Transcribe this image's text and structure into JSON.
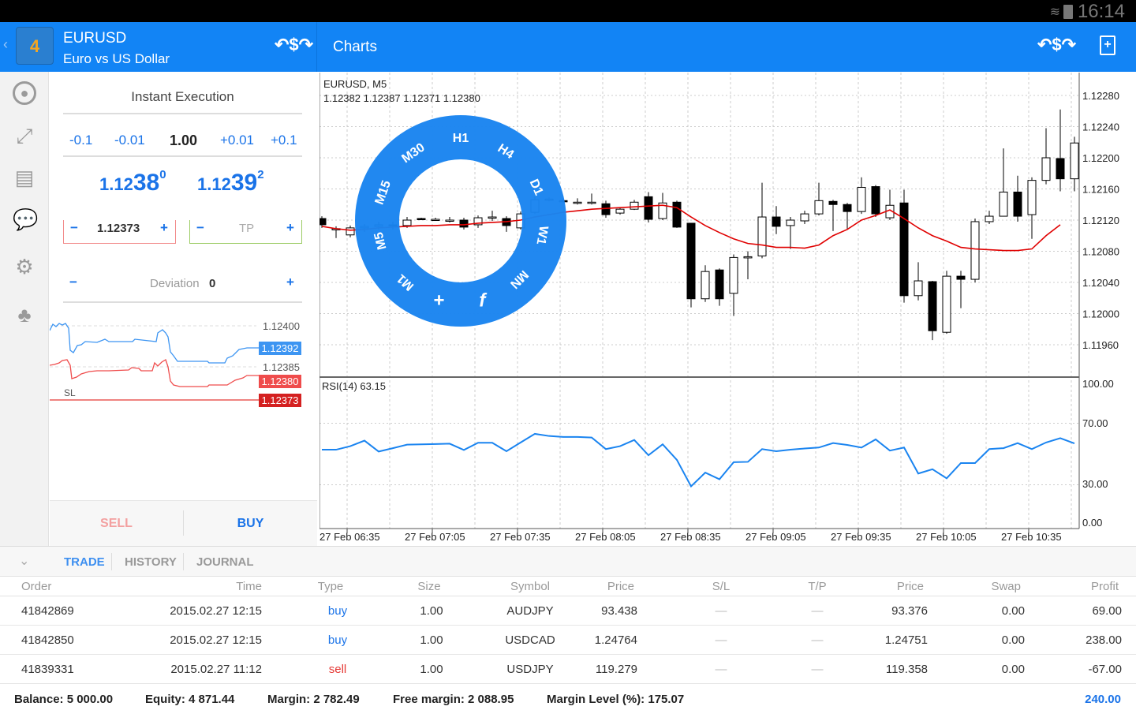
{
  "status_bar": {
    "time": "16:14",
    "wifi_icon": "wifi-icon",
    "battery_icon": "battery-icon"
  },
  "header": {
    "symbol": "EURUSD",
    "description": "Euro vs US Dollar",
    "section_title": "Charts",
    "logo_text": "4"
  },
  "colors": {
    "accent": "#1284f5",
    "sell": "#e53935",
    "buy": "#1a73e8",
    "sl_line": "#e53935",
    "tp_line": "#8bc34a",
    "ma": "#e00000",
    "rsi": "#1a84f0"
  },
  "sidebar": {
    "items": [
      {
        "icon": "account-icon"
      },
      {
        "icon": "trade-icon"
      },
      {
        "icon": "news-icon"
      },
      {
        "icon": "chat-icon"
      },
      {
        "icon": "settings-icon"
      },
      {
        "icon": "community-icon"
      }
    ]
  },
  "order": {
    "execution": "Instant Execution",
    "volume_steps": [
      "-0.1",
      "-0.01",
      "1.00",
      "+0.01",
      "+0.1"
    ],
    "bid": {
      "prefix": "1.12",
      "big": "38",
      "sup": "0"
    },
    "ask": {
      "prefix": "1.12",
      "big": "39",
      "sup": "2"
    },
    "sl": {
      "minus": "−",
      "value": "1.12373",
      "plus": "+"
    },
    "tp": {
      "minus": "−",
      "placeholder": "TP",
      "plus": "+"
    },
    "deviation": {
      "minus": "−",
      "label": "Deviation",
      "value": "0",
      "plus": "+"
    },
    "tick_chart": {
      "levels": [
        "1.12400",
        "1.12385"
      ],
      "ask_tag": "1.12392",
      "bid_tag": "1.12380",
      "sl_tag": "1.12373",
      "sl_label": "SL"
    },
    "sell_label": "SELL",
    "buy_label": "BUY"
  },
  "chart_data": {
    "type": "candlestick",
    "title": "EURUSD, M5",
    "ohlc_readout": "1.12382 1.12387 1.12371 1.12380",
    "y_ticks": [
      "1.12280",
      "1.12240",
      "1.12200",
      "1.12160",
      "1.12120",
      "1.12080",
      "1.12040",
      "1.12000",
      "1.11960"
    ],
    "x_ticks": [
      "27 Feb 06:35",
      "27 Feb 07:05",
      "27 Feb 07:35",
      "27 Feb 08:05",
      "27 Feb 08:35",
      "27 Feb 09:05",
      "27 Feb 09:35",
      "27 Feb 10:05",
      "27 Feb 10:35"
    ],
    "candles_ohlc": [
      [
        1.12122,
        1.12125,
        1.1211,
        1.12114
      ],
      [
        1.12108,
        1.12112,
        1.12097,
        1.12109
      ],
      [
        1.12101,
        1.12113,
        1.12098,
        1.1211
      ],
      [
        1.1211,
        1.12115,
        1.12105,
        1.12112
      ],
      [
        1.12112,
        1.12118,
        1.12108,
        1.12114
      ],
      [
        1.12114,
        1.12118,
        1.12108,
        1.12113
      ],
      [
        1.12113,
        1.12124,
        1.1211,
        1.1212
      ],
      [
        1.12122,
        1.12123,
        1.1212,
        1.12121
      ],
      [
        1.12121,
        1.12123,
        1.12119,
        1.12121
      ],
      [
        1.1212,
        1.12124,
        1.12117,
        1.1212
      ],
      [
        1.1212,
        1.12123,
        1.12108,
        1.12111
      ],
      [
        1.12114,
        1.12126,
        1.1211,
        1.12123
      ],
      [
        1.12124,
        1.12132,
        1.12119,
        1.12124
      ],
      [
        1.12122,
        1.12125,
        1.12105,
        1.12113
      ],
      [
        1.1211,
        1.12131,
        1.12108,
        1.12128
      ],
      [
        1.1213,
        1.1215,
        1.12128,
        1.12146
      ],
      [
        1.12146,
        1.12149,
        1.12144,
        1.12147
      ],
      [
        1.12145,
        1.12147,
        1.12142,
        1.12144
      ],
      [
        1.12143,
        1.12148,
        1.1214,
        1.12143
      ],
      [
        1.12143,
        1.12154,
        1.1214,
        1.12143
      ],
      [
        1.12141,
        1.12145,
        1.12123,
        1.12127
      ],
      [
        1.12129,
        1.12136,
        1.12127,
        1.12134
      ],
      [
        1.12134,
        1.12146,
        1.12133,
        1.12143
      ],
      [
        1.1215,
        1.12156,
        1.12117,
        1.12121
      ],
      [
        1.12122,
        1.12155,
        1.1212,
        1.12142
      ],
      [
        1.12143,
        1.12145,
        1.1211,
        1.12111
      ],
      [
        1.12116,
        1.12116,
        1.12008,
        1.12019
      ],
      [
        1.12019,
        1.12062,
        1.12015,
        1.12054
      ],
      [
        1.12056,
        1.12058,
        1.1201,
        1.12019
      ],
      [
        1.12026,
        1.12076,
        1.11997,
        1.12072
      ],
      [
        1.12073,
        1.1208,
        1.12044,
        1.12073
      ],
      [
        1.12074,
        1.12168,
        1.12071,
        1.12124
      ],
      [
        1.12124,
        1.12138,
        1.12102,
        1.12112
      ],
      [
        1.12113,
        1.12124,
        1.12083,
        1.1212
      ],
      [
        1.12119,
        1.12132,
        1.12115,
        1.12128
      ],
      [
        1.12128,
        1.12168,
        1.12126,
        1.12145
      ],
      [
        1.12144,
        1.12146,
        1.12106,
        1.1214
      ],
      [
        1.1214,
        1.12142,
        1.12109,
        1.12131
      ],
      [
        1.12131,
        1.12175,
        1.12128,
        1.12162
      ],
      [
        1.12163,
        1.12165,
        1.12124,
        1.12128
      ],
      [
        1.12123,
        1.12159,
        1.1212,
        1.12139
      ],
      [
        1.12142,
        1.12159,
        1.12014,
        1.12023
      ],
      [
        1.12023,
        1.12066,
        1.12017,
        1.12042
      ],
      [
        1.12041,
        1.12042,
        1.11966,
        1.11978
      ],
      [
        1.11976,
        1.12055,
        1.11974,
        1.12048
      ],
      [
        1.12048,
        1.12055,
        1.12007,
        1.12044
      ],
      [
        1.12044,
        1.12122,
        1.1204,
        1.12118
      ],
      [
        1.12118,
        1.12132,
        1.12115,
        1.12125
      ],
      [
        1.12125,
        1.12212,
        1.12125,
        1.12156
      ],
      [
        1.12156,
        1.12177,
        1.12118,
        1.12125
      ],
      [
        1.12127,
        1.12175,
        1.12096,
        1.12171
      ],
      [
        1.12171,
        1.12238,
        1.12166,
        1.122
      ],
      [
        1.12199,
        1.12262,
        1.12157,
        1.12173
      ],
      [
        1.12173,
        1.12227,
        1.12157,
        1.12219
      ]
    ],
    "moving_average": [
      1.12112,
      1.12109,
      1.12107,
      1.12108,
      1.1211,
      1.12111,
      1.12112,
      1.12113,
      1.12113,
      1.12114,
      1.12114,
      1.12116,
      1.12117,
      1.12118,
      1.1212,
      1.12124,
      1.12127,
      1.1213,
      1.12132,
      1.12134,
      1.12135,
      1.12136,
      1.12137,
      1.12138,
      1.12139,
      1.12136,
      1.12124,
      1.12113,
      1.12104,
      1.12096,
      1.1209,
      1.12088,
      1.12085,
      1.12085,
      1.12084,
      1.12088,
      1.121,
      1.12108,
      1.1212,
      1.12126,
      1.12133,
      1.12122,
      1.1211,
      1.121,
      1.12093,
      1.12085,
      1.12083,
      1.12082,
      1.12081,
      1.12081,
      1.12083,
      1.121,
      1.12114
    ],
    "rsi": {
      "label": "RSI(14) 63.15",
      "y_ticks": [
        "100.00",
        "70.00",
        "30.00",
        "0.00"
      ],
      "values": [
        52.8,
        52.8,
        55.1,
        58.7,
        51.6,
        53.8,
        56.1,
        56.3,
        56.5,
        56.7,
        52.6,
        57.3,
        57.3,
        51.8,
        57.5,
        63.1,
        61.7,
        61.1,
        61.1,
        60.7,
        53.2,
        55.1,
        59.1,
        49.2,
        56.3,
        46.2,
        29.0,
        37.9,
        33.6,
        44.7,
        44.9,
        53.2,
        51.8,
        52.8,
        53.6,
        54.2,
        57.1,
        55.9,
        54.2,
        59.5,
        52.2,
        54.2,
        37.3,
        40.1,
        34.2,
        44.1,
        44.1,
        53.2,
        53.8,
        57.1,
        53.2,
        57.5,
        60.3,
        56.9
      ]
    },
    "timeframe_wheel": [
      "H1",
      "H4",
      "D1",
      "W1",
      "MN",
      "f",
      "+",
      "M1",
      "M5",
      "M15",
      "M30"
    ]
  },
  "bottom": {
    "tabs": [
      "TRADE",
      "HISTORY",
      "JOURNAL"
    ],
    "columns": [
      "Order",
      "Time",
      "Type",
      "Size",
      "Symbol",
      "Price",
      "S/L",
      "T/P",
      "Price",
      "Swap",
      "Profit"
    ],
    "rows": [
      [
        "41842869",
        "2015.02.27 12:15",
        "buy",
        "1.00",
        "AUDJPY",
        "93.438",
        "—",
        "—",
        "93.376",
        "0.00",
        "69.00"
      ],
      [
        "41842850",
        "2015.02.27 12:15",
        "buy",
        "1.00",
        "USDCAD",
        "1.24764",
        "—",
        "—",
        "1.24751",
        "0.00",
        "238.00"
      ],
      [
        "41839331",
        "2015.02.27 11:12",
        "sell",
        "1.00",
        "USDJPY",
        "119.279",
        "—",
        "—",
        "119.358",
        "0.00",
        "-67.00"
      ]
    ],
    "footer": {
      "balance": "Balance:  5 000.00",
      "equity": "Equity:  4 871.44",
      "margin": "Margin:  2 782.49",
      "free_margin": "Free margin:  2 088.95",
      "margin_level": "Margin Level (%):  175.07",
      "total": "240.00"
    }
  }
}
